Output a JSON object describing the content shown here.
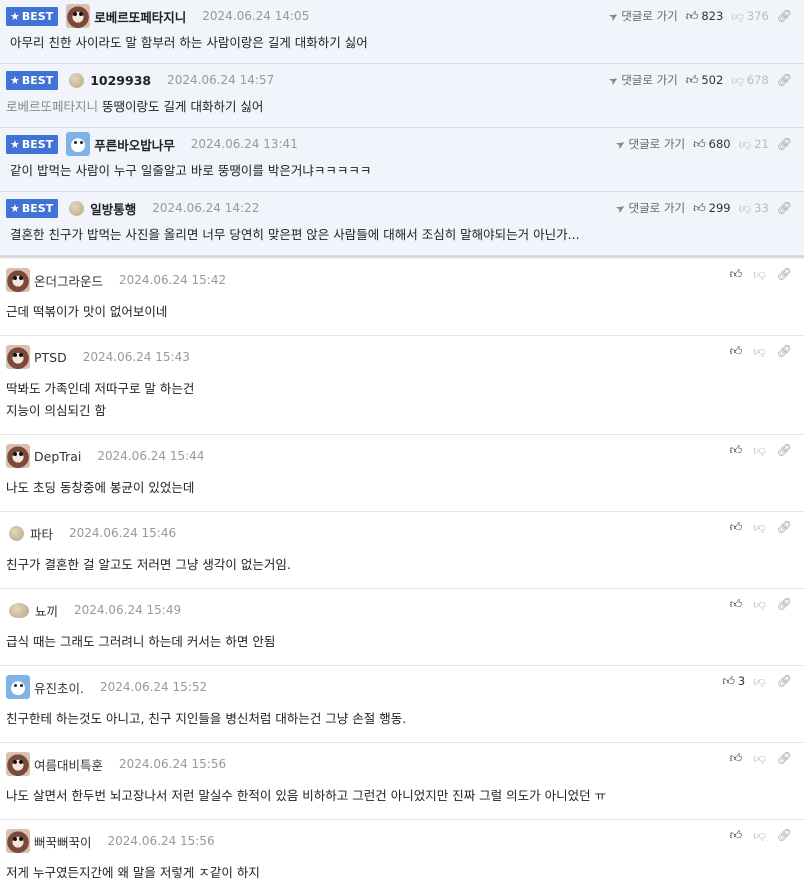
{
  "best_label": "BEST",
  "goto_label": "댓글로 가기",
  "best_comments": [
    {
      "avatar": "bear-avatar",
      "name": "로베르또페타지니",
      "date": "2024.06.24 14:05",
      "up": "823",
      "down": "376",
      "mention": "",
      "text": "아무리 친한 사이라도 말 함부러 하는 사람이랑은 길게 대화하기 싫어"
    },
    {
      "avatar": "dot-avatar",
      "name": "1029938",
      "date": "2024.06.24 14:57",
      "up": "502",
      "down": "678",
      "mention": "로베르또페타지니",
      "text": "뚱땡이랑도 길게 대화하기 싫어"
    },
    {
      "avatar": "blue-avatar",
      "name": "푸른바오밥나무",
      "date": "2024.06.24 13:41",
      "up": "680",
      "down": "21",
      "mention": "",
      "text": "같이 밥먹는 사람이 누구 일줄알고 바로 뚱땡이를 박은거냐ㅋㅋㅋㅋㅋ"
    },
    {
      "avatar": "dot-avatar",
      "name": "일방통행",
      "date": "2024.06.24 14:22",
      "up": "299",
      "down": "33",
      "mention": "",
      "text": "결혼한 친구가 밥먹는 사진을 올리면 너무 당연히 맞은편 앉은 사람들에 대해서 조심히 말해야되는거 아닌가..."
    }
  ],
  "comments": [
    {
      "avatar": "bear-avatar",
      "name": "온더그라운드",
      "date": "2024.06.24 15:42",
      "up": "",
      "text": "근데 떡볶이가 맛이 없어보이네"
    },
    {
      "avatar": "bear-avatar",
      "name": "PTSD",
      "date": "2024.06.24 15:43",
      "up": "",
      "text": "딱봐도 가족인데 저따구로 말 하는건\n지능이 의심되긴 함"
    },
    {
      "avatar": "bear-avatar",
      "name": "DepTrai",
      "date": "2024.06.24 15:44",
      "up": "",
      "text": "나도 초딩 동창중에 봉균이 있었는데"
    },
    {
      "avatar": "dot-avatar",
      "name": "파타",
      "date": "2024.06.24 15:46",
      "up": "",
      "text": "친구가 결혼한 걸 알고도 저러면 그냥 생각이 없는거임."
    },
    {
      "avatar": "flat-dot-avatar",
      "name": "뇨끼",
      "date": "2024.06.24 15:49",
      "up": "",
      "text": "급식 때는 그래도 그러려니 하는데 커서는 하면 안됨"
    },
    {
      "avatar": "blue-avatar",
      "name": "유진초이.",
      "date": "2024.06.24 15:52",
      "up": "3",
      "text": "친구한테 하는것도 아니고, 친구 지인들을 병신처럼 대하는건 그냥 손절 행동."
    },
    {
      "avatar": "bear-avatar",
      "name": "여름대비특훈",
      "date": "2024.06.24 15:56",
      "up": "",
      "text": "나도 살면서 한두번 뇌고장나서 저런 말실수 한적이 있음 비하하고 그런건 아니었지만 진짜 그럴 의도가 아니었던 ㅠ"
    },
    {
      "avatar": "bear-avatar",
      "name": "뻐꾹뻐꾹이",
      "date": "2024.06.24 15:56",
      "up": "",
      "text": "저게 누구였든지간에 왜 말을 저렇게 ㅈ같이 하지"
    }
  ]
}
